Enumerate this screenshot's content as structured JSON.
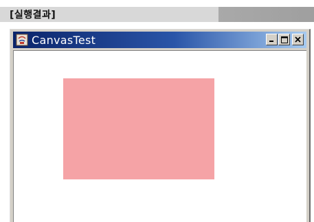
{
  "header": {
    "label": "[실행결과]"
  },
  "window": {
    "title": "CanvasTest",
    "icon": "java-app-icon",
    "controls": [
      "minimize-icon",
      "maximize-icon",
      "close-icon"
    ]
  },
  "canvas": {
    "shape": "filled-rectangle",
    "fill_color": "#f5a3a6"
  },
  "colors": {
    "titlebar_start": "#0a246a",
    "titlebar_end": "#a6caf0",
    "window_frame": "#d4d0c8"
  }
}
